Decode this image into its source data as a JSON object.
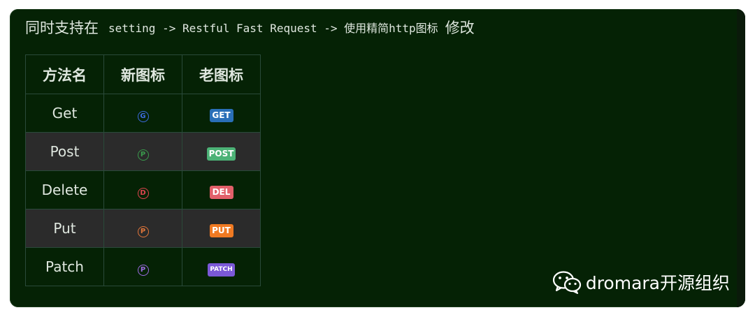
{
  "intro": {
    "lead": "同时支持在",
    "code": "setting -> Restful Fast Request -> 使用精简http图标",
    "tail": "修改"
  },
  "table": {
    "headers": [
      "方法名",
      "新图标",
      "老图标"
    ],
    "rows": [
      {
        "method": "Get",
        "new_icon_letter": "G",
        "new_icon_color": "#3d6be0",
        "old_badge": "GET",
        "old_badge_color": "#2a6fb8"
      },
      {
        "method": "Post",
        "new_icon_letter": "P",
        "new_icon_color": "#3a9a4c",
        "old_badge": "POST",
        "old_badge_color": "#4cb276"
      },
      {
        "method": "Delete",
        "new_icon_letter": "D",
        "new_icon_color": "#e0454f",
        "old_badge": "DEL",
        "old_badge_color": "#e2606a"
      },
      {
        "method": "Put",
        "new_icon_letter": "P",
        "new_icon_color": "#e0763a",
        "old_badge": "PUT",
        "old_badge_color": "#f07a22"
      },
      {
        "method": "Patch",
        "new_icon_letter": "P",
        "new_icon_color": "#9b6be0",
        "old_badge": "PATCH",
        "old_badge_color": "#7b58d8"
      }
    ]
  },
  "watermark": {
    "icon": "wechat-icon",
    "text": "dromara开源组织"
  }
}
